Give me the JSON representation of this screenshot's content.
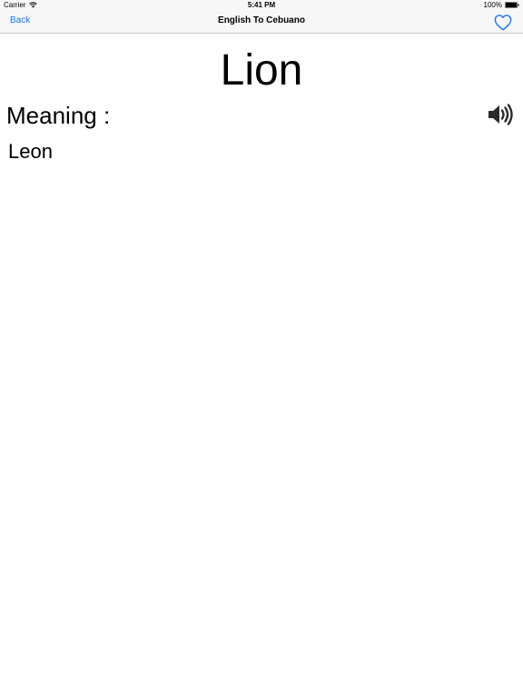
{
  "status_bar": {
    "carrier": "Carrier",
    "time": "5:41 PM",
    "battery": "100%"
  },
  "nav": {
    "back_label": "Back",
    "title": "English To Cebuano",
    "favorite_icon": "heart-outline-icon",
    "accent_color": "#1a73e8"
  },
  "entry": {
    "word": "Lion",
    "meaning_label": "Meaning :",
    "meaning": "Leon",
    "speaker_icon": "speaker-icon"
  }
}
